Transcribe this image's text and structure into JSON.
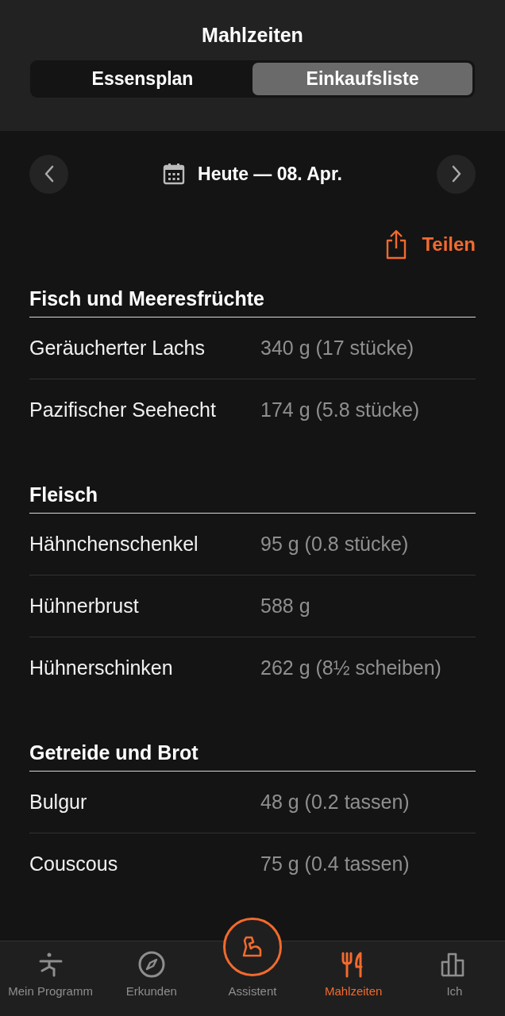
{
  "title": "Mahlzeiten",
  "segments": [
    {
      "label": "Essensplan",
      "selected": false
    },
    {
      "label": "Einkaufsliste",
      "selected": true
    }
  ],
  "date": "Heute — 08. Apr.",
  "share": "Teilen",
  "sections": [
    {
      "heading": "Fisch und Meeresfrüchte",
      "items": [
        {
          "name": "Geräucherter Lachs",
          "amount": "340 g (17 stücke)"
        },
        {
          "name": "Pazifischer Seehecht",
          "amount": "174 g (5.8 stücke)"
        }
      ]
    },
    {
      "heading": "Fleisch",
      "items": [
        {
          "name": "Hähnchenschenkel",
          "amount": "95 g (0.8 stücke)"
        },
        {
          "name": "Hühnerbrust",
          "amount": "588 g"
        },
        {
          "name": "Hühnerschinken",
          "amount": "262 g (8½ scheiben)"
        }
      ]
    },
    {
      "heading": "Getreide und Brot",
      "items": [
        {
          "name": "Bulgur",
          "amount": "48 g (0.2 tassen)"
        },
        {
          "name": "Couscous",
          "amount": "75 g (0.4 tassen)"
        }
      ]
    }
  ],
  "tabs": [
    {
      "label": "Mein Programm",
      "kind": "figure",
      "selected": false
    },
    {
      "label": "Erkunden",
      "kind": "compass",
      "selected": false
    },
    {
      "label": "Assistent",
      "kind": "arm",
      "selected": false
    },
    {
      "label": "Mahlzeiten",
      "kind": "cutlery",
      "selected": true
    },
    {
      "label": "Ich",
      "kind": "chart",
      "selected": false
    }
  ]
}
